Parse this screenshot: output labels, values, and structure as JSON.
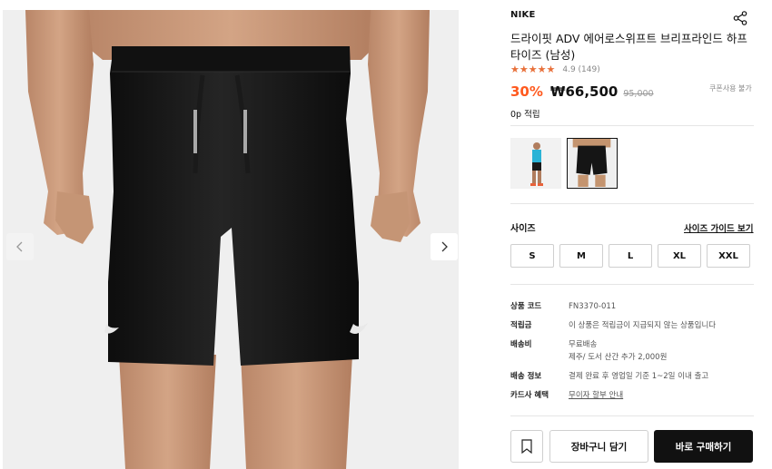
{
  "product": {
    "brand": "NIKE",
    "title": "드라이핏 ADV 에어로스위프트 브리프라인드 하프타이즈 (남성)",
    "rating_text": "4.9 (149)",
    "rating_value": 4.9,
    "discount": "30%",
    "price": "₩66,500",
    "original_price": "95,000",
    "coupon_note": "쿠폰사용 불가",
    "points": "0p 적립",
    "thumbnails": [
      "thumb-model-full",
      "thumb-tights"
    ]
  },
  "sizes": {
    "label": "사이즈",
    "guide_label": "사이즈 가이드 보기",
    "options": [
      "S",
      "M",
      "L",
      "XL",
      "XXL"
    ]
  },
  "specs": {
    "code_key": "상품 코드",
    "code_val": "FN3370-011",
    "points_key": "적립금",
    "points_val": "이 상품은 적립금이 지급되지 않는 상품입니다",
    "shipping_key": "배송비",
    "shipping_val1": "무료배송",
    "shipping_val2": "제주/ 도서 산간 추가 2,000원",
    "delivery_key": "배송 정보",
    "delivery_val": "결제 완료 후 영업일 기준 1~2일 이내 출고",
    "card_key": "카드사 혜택",
    "card_val": "무이자 할부 안내"
  },
  "actions": {
    "cart_label": "장바구니 담기",
    "buy_label": "바로 구매하기"
  },
  "colors": {
    "accent": "#ff5a1f",
    "stars": "#e8703a",
    "primary_button": "#111111"
  },
  "icons": {
    "share": "share-icon",
    "prev": "chevron-left-icon",
    "next": "chevron-right-icon",
    "wishlist": "bookmark-icon",
    "star": "star-icon"
  }
}
